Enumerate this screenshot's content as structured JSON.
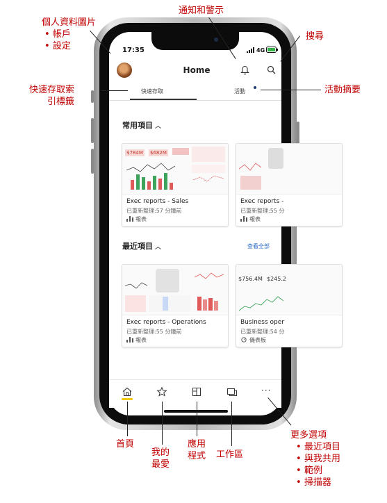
{
  "callouts": {
    "profile": {
      "title": "個人資料圖片",
      "items": [
        "帳戶",
        "設定"
      ]
    },
    "notifications": "通知和警示",
    "search": "搜尋",
    "quick_access_tab": {
      "line1": "快速存取索",
      "line2": "引標籤"
    },
    "activity_feed": "活動摘要",
    "home": "首頁",
    "favorites": {
      "line1": "我的",
      "line2": "最愛"
    },
    "apps": {
      "line1": "應用",
      "line2": "程式"
    },
    "workspaces": "工作區",
    "more": {
      "title": "更多選項",
      "items": [
        "最近項目",
        "與我共用",
        "範例",
        "掃描器"
      ]
    }
  },
  "status_bar": {
    "time": "17:35",
    "network": "4G"
  },
  "header": {
    "title": "Home"
  },
  "tabs": {
    "quick_access": "快速存取",
    "activity": "活動"
  },
  "frequents": {
    "title": "常用項目",
    "cards": [
      {
        "title": "Exec reports - Sales",
        "subtitle": "已重新整理:57 分鐘前",
        "type": "報表",
        "kpis": [
          "$784M",
          "$682M"
        ]
      },
      {
        "title": "Exec reports -",
        "subtitle": "已重新整理:55 分",
        "type": "報表"
      }
    ]
  },
  "recents": {
    "title": "最近項目",
    "see_all": "查看全部",
    "cards": [
      {
        "title": "Exec reports - Operations",
        "subtitle": "已重新整理:55 分鐘前",
        "type": "報表"
      },
      {
        "title": "Business oper",
        "subtitle": "已重新整理:54 分",
        "type": "儀表板",
        "kpis": [
          "$756.4M",
          "$245.2"
        ]
      }
    ]
  },
  "nav": {
    "items": [
      "home-icon",
      "star-icon",
      "apps-icon",
      "workspaces-icon",
      "more-icon"
    ]
  },
  "colors": {
    "callout": "#c00000",
    "accent": "#f2c811",
    "link": "#2f6fc9"
  }
}
